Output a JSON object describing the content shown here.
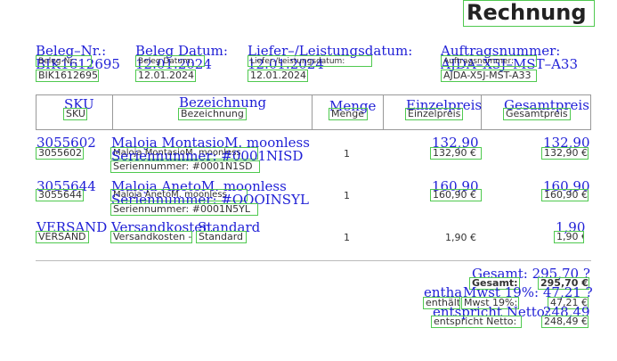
{
  "title": "Rechnung",
  "meta": {
    "beleg_nr": {
      "label": "Beleg-Nr.:",
      "value": "BIK1612695",
      "ocr_label": "Beleg–Nr.:",
      "ocr_value": "BIK1612695"
    },
    "beleg_datum": {
      "label": "Beleg Datum:",
      "value": "12.01.2024",
      "ocr_label": "Beleg Datum:",
      "ocr_value": "12.01.2024"
    },
    "lieferdatum": {
      "label": "Liefer-/Leistungsdatum:",
      "value": "12.01.2024",
      "ocr_label": "Liefer–/Leistungsdatum:",
      "ocr_value": "12.01.2024"
    },
    "auftrag": {
      "label": "Auftragsnummer:",
      "value": "AJDA-X5J-MST-A33",
      "ocr_label": "Auftragsnummer:",
      "ocr_value": "AJDA–X5J–MST–A33"
    }
  },
  "table": {
    "headers": {
      "sku": {
        "label": "SKU",
        "ocr": "SKU"
      },
      "bezeichnung": {
        "label": "Bezeichnung",
        "ocr": "Bezeichnung"
      },
      "menge": {
        "label": "Menge",
        "ocr": "Menge"
      },
      "einzelpreis": {
        "label": "Einzelpreis",
        "ocr": "Einzelpreis"
      },
      "gesamtpreis": {
        "label": "Gesamtpreis",
        "ocr": "Gesamtpreis"
      }
    },
    "rows": [
      {
        "sku": "3055602",
        "sku_ocr": "3055602",
        "name": "Maloja MontasioM. moonless",
        "name_ocr": "Maloja MontasioM. moonless",
        "serial": "Seriennummer: #0001N1SD",
        "serial_ocr": "Seriennummer: #0001NISD",
        "qty": "1",
        "unit": "132,90 €",
        "unit_ocr": "132,90",
        "total": "132,90 €",
        "total_ocr": "132,90"
      },
      {
        "sku": "3055644",
        "sku_ocr": "3055644",
        "name": "Maloja AnetoM. moonless",
        "name_ocr": "Maloja AnetoM. moonless",
        "serial": "Seriennummer: #0001N5YL",
        "serial_ocr": "Seriennummer: #OOOINSYL",
        "qty": "1",
        "unit": "160,90 €",
        "unit_ocr": "160,90",
        "total": "160,90 €",
        "total_ocr": "160,90"
      },
      {
        "sku": "VERSAND",
        "sku_ocr": "VERSAND",
        "name": "Versandkosten -",
        "name2": "Standard",
        "name_ocr": "Versandkosten",
        "name2_ocr": "Standard",
        "qty": "1",
        "unit": "1,90 €",
        "total": "1,90 €",
        "total_ocr": "1,90"
      }
    ]
  },
  "totals": {
    "gesamt": {
      "label": "Gesamt:",
      "value": "295,70 €",
      "ocr": "Gesamt: 295,70 ?"
    },
    "mwst": {
      "label": "enthält Mwst 19%:",
      "label_a": "enthält",
      "label_b": "Mwst 19%:",
      "value": "47,21 €",
      "ocr_a": "entha",
      "ocr_b": "Mwst 19%: 47,21 ?"
    },
    "netto": {
      "label": "entspricht Netto:",
      "value": "248,49 €",
      "ocr": "entspricht Netto:",
      "ocr_value": "248,49"
    }
  }
}
